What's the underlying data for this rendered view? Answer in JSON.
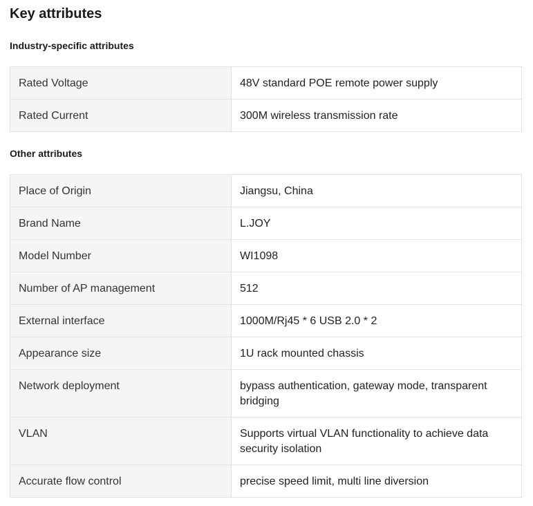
{
  "title": "Key attributes",
  "industry": {
    "heading": "Industry-specific attributes",
    "rows": [
      {
        "key": "Rated Voltage",
        "value": "48V standard POE remote power supply"
      },
      {
        "key": "Rated Current",
        "value": "300M wireless transmission rate"
      }
    ]
  },
  "other": {
    "heading": "Other attributes",
    "rows": [
      {
        "key": "Place of Origin",
        "value": "Jiangsu, China"
      },
      {
        "key": "Brand Name",
        "value": "L.JOY"
      },
      {
        "key": "Model Number",
        "value": "WI1098"
      },
      {
        "key": "Number of AP management",
        "value": "512"
      },
      {
        "key": "External interface",
        "value": "1000M/Rj45 * 6 USB 2.0 * 2"
      },
      {
        "key": "Appearance size",
        "value": "1U rack mounted chassis"
      },
      {
        "key": "Network deployment",
        "value": "bypass authentication, gateway mode, transparent bridging"
      },
      {
        "key": "VLAN",
        "value": "Supports virtual VLAN functionality to achieve data security isolation"
      },
      {
        "key": "Accurate flow control",
        "value": "precise speed limit, multi line diversion"
      }
    ]
  }
}
